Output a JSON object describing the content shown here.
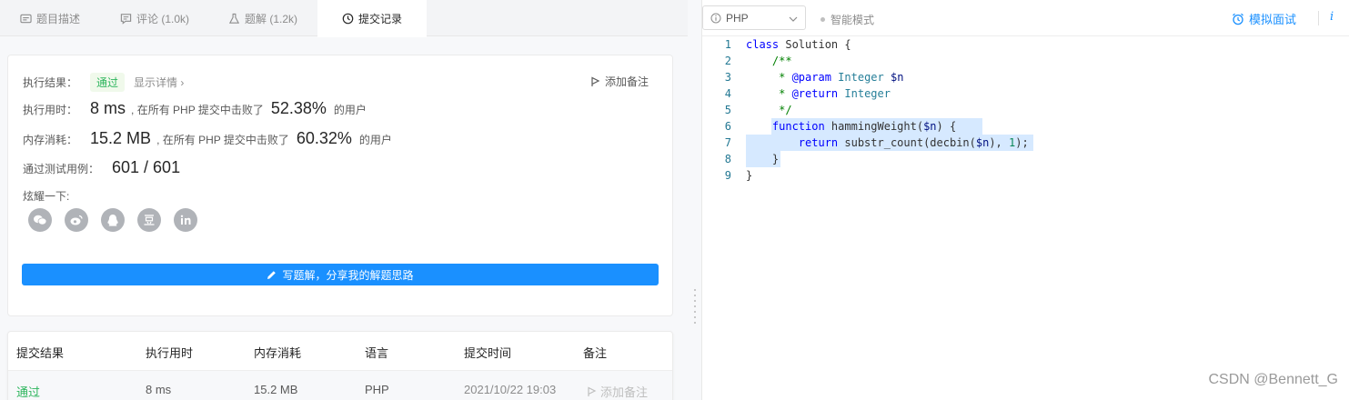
{
  "tabs": [
    {
      "label": "题目描述",
      "icon": "description-icon"
    },
    {
      "label": "评论 (1.0k)",
      "icon": "comment-icon"
    },
    {
      "label": "题解 (1.2k)",
      "icon": "flask-icon"
    },
    {
      "label": "提交记录",
      "icon": "clock-icon"
    }
  ],
  "result": {
    "status_label": "执行结果：",
    "status": "通过",
    "details": "显示详情 ›",
    "add_note": "添加备注",
    "time_label": "执行用时：",
    "time_value": "8 ms",
    "time_prefix": ", 在所有 PHP 提交中击败了",
    "time_percent": "52.38%",
    "time_suffix": "的用户",
    "mem_label": "内存消耗：",
    "mem_value": "15.2 MB",
    "mem_prefix": ", 在所有 PHP 提交中击败了",
    "mem_percent": "60.32%",
    "mem_suffix": "的用户",
    "cases_label": "通过测试用例：",
    "cases_value": "601 / 601",
    "share_label": "炫耀一下:",
    "share_icons": [
      "wechat-icon",
      "weibo-icon",
      "qq-icon",
      "douban-icon",
      "linkedin-icon"
    ],
    "write_button": "写题解，分享我的解题思路"
  },
  "table": {
    "headers": [
      "提交结果",
      "执行用时",
      "内存消耗",
      "语言",
      "提交时间",
      "备注"
    ],
    "rows": [
      {
        "status": "通过",
        "time": "8 ms",
        "memory": "15.2 MB",
        "lang": "PHP",
        "submitted": "2021/10/22 19:03",
        "note": "添加备注"
      }
    ]
  },
  "editor": {
    "language": "PHP",
    "mode": "智能模式",
    "mock_interview": "模拟面试",
    "info": "i",
    "lines": [
      {
        "n": "1",
        "text": "class Solution {"
      },
      {
        "n": "2",
        "text": "    /**"
      },
      {
        "n": "3",
        "text": "     * @param Integer $n"
      },
      {
        "n": "4",
        "text": "     * @return Integer"
      },
      {
        "n": "5",
        "text": "     */"
      },
      {
        "n": "6",
        "text": "    function hammingWeight($n) {"
      },
      {
        "n": "7",
        "text": "        return substr_count(decbin($n), 1);"
      },
      {
        "n": "8",
        "text": "    }"
      },
      {
        "n": "9",
        "text": "}"
      }
    ]
  },
  "watermark": "CSDN @Bennett_G",
  "colors": {
    "accent": "#1a90ff",
    "success": "#2db55d"
  }
}
